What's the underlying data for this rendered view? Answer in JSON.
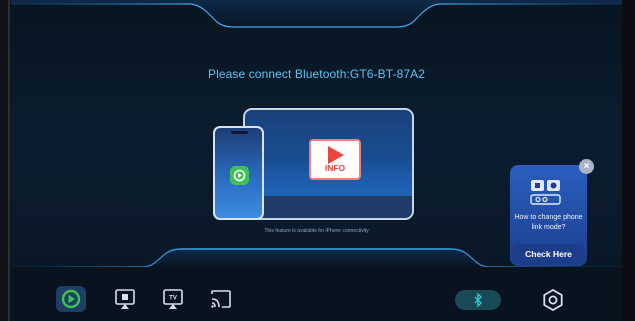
{
  "connect_message": "Please connect Bluetooth:GT6-BT-87A2",
  "illustration": {
    "info_label": "INFO",
    "carplay_icon": "carplay-icon"
  },
  "footnote": "This feature is available for iPhone connectivity",
  "popup": {
    "question": "How to change phone link mode?",
    "button_label": "Check Here",
    "close_icon": "close-icon"
  },
  "dock": {
    "items": [
      {
        "name": "carplay",
        "icon": "carplay-icon",
        "active": true
      },
      {
        "name": "screen-mirror",
        "icon": "mirror-icon",
        "active": false
      },
      {
        "name": "tv-cast",
        "icon": "tv-icon",
        "active": false,
        "label": "TV"
      },
      {
        "name": "cast",
        "icon": "cast-icon",
        "active": false
      }
    ],
    "bluetooth_icon": "bluetooth-icon",
    "settings_icon": "settings-icon"
  },
  "colors": {
    "accent": "#5cc3f0",
    "active_green": "#3fc254",
    "popup_blue": "#2a5ec0"
  }
}
